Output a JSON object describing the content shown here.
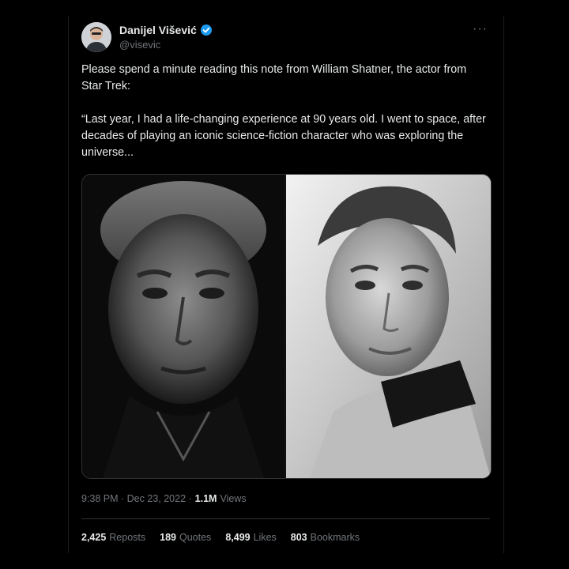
{
  "tweet": {
    "author": {
      "name": "Danijel Višević",
      "handle": "@visevic",
      "verified": true
    },
    "text": [
      "Please spend a minute reading this note from William Shatner, the actor from Star Trek:",
      "“Last year, I had a life-changing experience at 90 years old. I went to space, after decades of playing an iconic science-fiction character who was exploring the universe..."
    ],
    "media": [
      {
        "icon": "portrait-photo-older-man"
      },
      {
        "icon": "portrait-photo-young-man-star-trek-uniform"
      }
    ],
    "timestamp": "9:38 PM · Dec 23, 2022 ·",
    "views": {
      "count": "1.1M",
      "label": "Views"
    },
    "stats": [
      {
        "count": "2,425",
        "label": "Reposts"
      },
      {
        "count": "189",
        "label": "Quotes"
      },
      {
        "count": "8,499",
        "label": "Likes"
      },
      {
        "count": "803",
        "label": "Bookmarks"
      }
    ]
  },
  "colors": {
    "background": "#000000",
    "text_primary": "#e7e9ea",
    "text_secondary": "#71767b",
    "border": "#2f3336",
    "verified_blue": "#1d9bf0"
  }
}
